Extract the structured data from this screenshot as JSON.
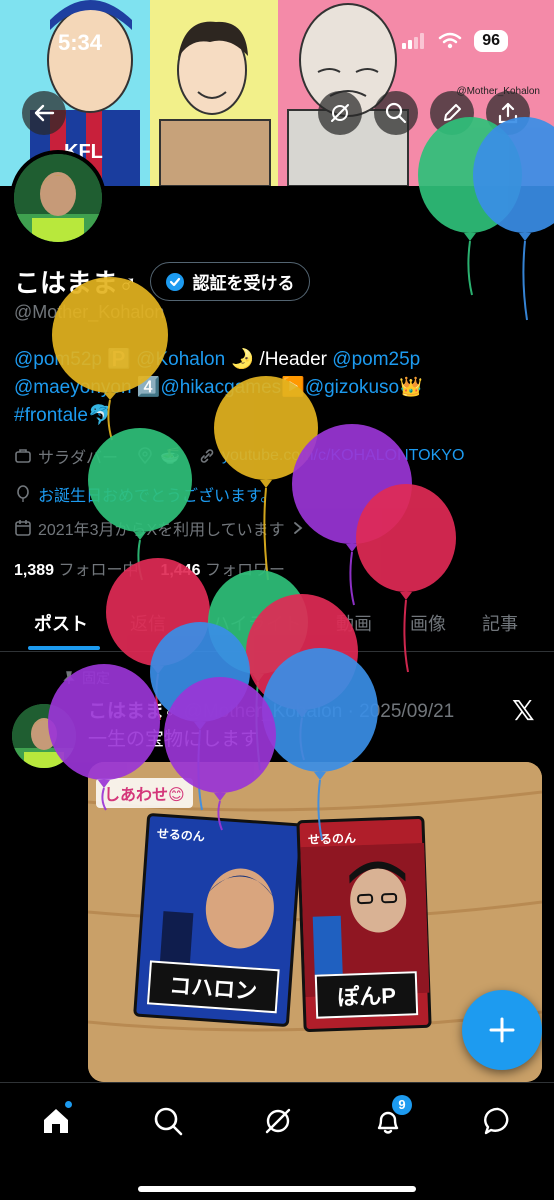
{
  "status_bar": {
    "time": "5:34",
    "battery": "96"
  },
  "header": {
    "watermark": "@Mother_Kohalon",
    "buttons": [
      {
        "name": "back-arrow-icon"
      },
      {
        "name": "grok-icon"
      },
      {
        "name": "search-icon"
      },
      {
        "name": "edit-icon"
      },
      {
        "name": "share-icon"
      }
    ]
  },
  "profile": {
    "name": "こはまま♂",
    "verify_label": "認証を受ける",
    "handle": "@Mother_Kohalon",
    "bio": {
      "line1": [
        {
          "text": "@pom52p",
          "link": true
        },
        {
          "text": " 🅿️ ",
          "link": false
        },
        {
          "text": "@Kohalon",
          "link": true
        },
        {
          "text": " 🌛 /Header ",
          "link": false
        },
        {
          "text": "@pom25p",
          "link": true
        }
      ],
      "line2": [
        {
          "text": "@maeyonyon",
          "link": true
        },
        {
          "text": " 4️⃣",
          "link": false
        },
        {
          "text": "@hikacgames",
          "link": true
        },
        {
          "text": "▶️",
          "link": false
        },
        {
          "text": "@gizokuso",
          "link": true
        },
        {
          "text": "👑",
          "link": false
        }
      ],
      "line3": [
        {
          "text": "#frontale",
          "link": true
        },
        {
          "text": "🐬",
          "link": false
        }
      ]
    },
    "occupation": "サラダバー",
    "location": "🍜",
    "website": "youtube.com/c/KOHALONTOKYO",
    "birthday": "お誕生日おめでとうございます。",
    "joined": "2021年3月からXを利用しています",
    "following_count": "1,389",
    "following_label": "フォロー中",
    "followers_count": "1,446",
    "followers_label": "フォロワー"
  },
  "tabs": [
    "ポスト",
    "返信",
    "ハイライト",
    "動画",
    "画像",
    "記事"
  ],
  "post": {
    "pinned_label": "固定",
    "author": "こはまま♂",
    "handle_date": "@Mother_Kohalon · 2025/09/21",
    "text": "一生の宝物にします",
    "image": {
      "caption": "しあわせ😊",
      "card1_brand": "せるのん",
      "card1_label": "コハロン",
      "card2_brand": "せるのん",
      "card2_label": "ぽんP"
    }
  },
  "nav": {
    "notification_badge": "9"
  },
  "colors": {
    "accent": "#1d9bf0",
    "background": "#000000",
    "muted": "#71767b"
  }
}
